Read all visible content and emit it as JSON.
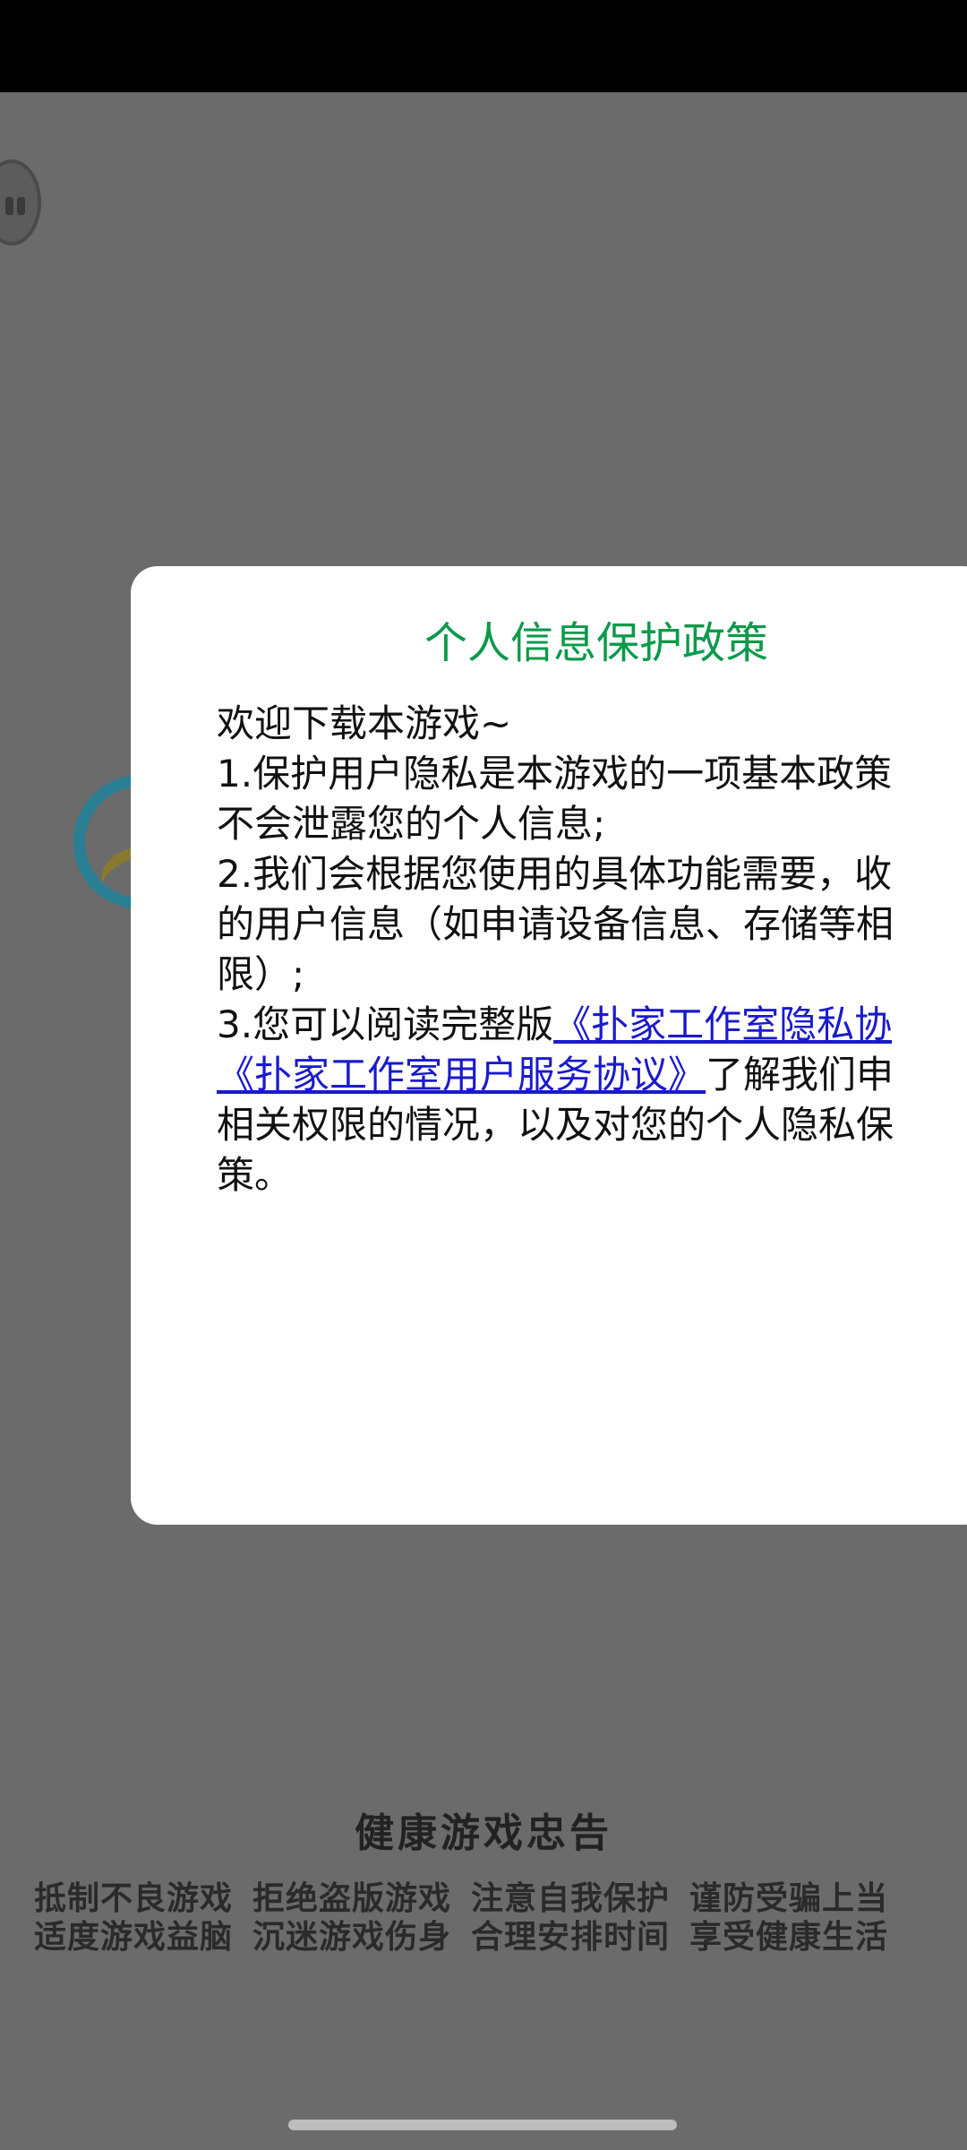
{
  "dialog": {
    "title": "个人信息保护政策",
    "line1": "欢迎下载本游戏~",
    "line2": "1.保护用户隐私是本游戏的一项基本政策",
    "line3": "不会泄露您的个人信息;",
    "line4": "2.我们会根据您使用的具体功能需要，收",
    "line5": "的用户信息（如申请设备信息、存储等相",
    "line6": "限）;",
    "line7_prefix": "3.您可以阅读完整版",
    "link_privacy": "《扑家工作室隐私协",
    "link_service": "《扑家工作室用户服务协议》",
    "line8_suffix": "了解我们申",
    "line9": "相关权限的情况，以及对您的个人隐私保",
    "line10": "策。"
  },
  "advice": {
    "title": "健康游戏忠告",
    "row1": [
      "抵制不良游戏",
      "拒绝盗版游戏",
      "注意自我保护",
      "谨防受骗上当"
    ],
    "row2": [
      "适度游戏益脑",
      "沉迷游戏伤身",
      "合理安排时间",
      "享受健康生活"
    ]
  },
  "colors": {
    "title_green": "#0a9a4a",
    "link_blue": "#1a1acc",
    "overlay": "#6b6b6b"
  }
}
